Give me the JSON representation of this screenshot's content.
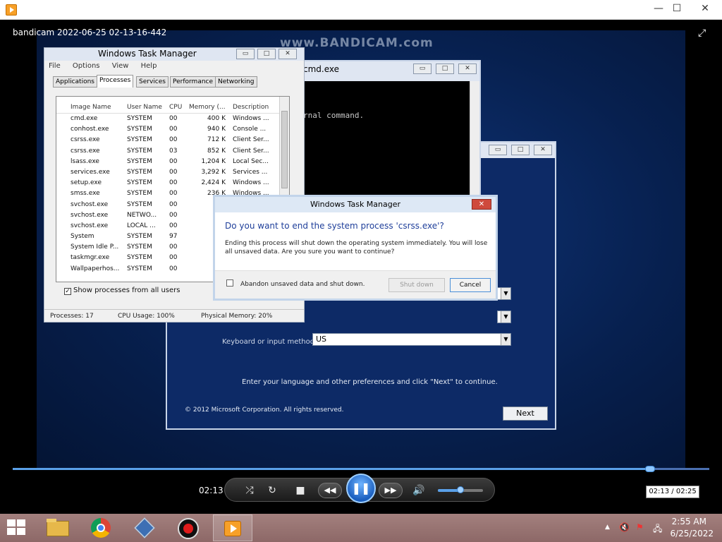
{
  "player": {
    "video_title": "bandicam 2022-06-25 02-13-16-442",
    "elapsed": "02:13",
    "tooltip_time": "02:13 / 02:25",
    "progress_fraction": 0.915,
    "volume_fraction": 0.5,
    "controls": {
      "shuffle_icon": "shuffle-icon",
      "repeat_icon": "repeat-icon",
      "stop_icon": "stop-icon",
      "prev_icon": "rewind-icon",
      "play_icon": "pause-icon",
      "next_icon": "fast-forward-icon",
      "volume_icon": "speaker-icon"
    }
  },
  "watermark": "www.BANDICAM.com",
  "taskmgr": {
    "title": "Windows Task Manager",
    "menu": [
      "File",
      "Options",
      "View",
      "Help"
    ],
    "tabs": [
      "Applications",
      "Processes",
      "Services",
      "Performance",
      "Networking"
    ],
    "active_tab": "Processes",
    "columns": [
      "Image Name",
      "User Name",
      "CPU",
      "Memory (...",
      "Description"
    ],
    "rows": [
      [
        "cmd.exe",
        "SYSTEM",
        "00",
        "400 K",
        "Windows ..."
      ],
      [
        "conhost.exe",
        "SYSTEM",
        "00",
        "940 K",
        "Console ..."
      ],
      [
        "csrss.exe",
        "SYSTEM",
        "00",
        "712 K",
        "Client Ser..."
      ],
      [
        "csrss.exe",
        "SYSTEM",
        "03",
        "852 K",
        "Client Ser..."
      ],
      [
        "lsass.exe",
        "SYSTEM",
        "00",
        "1,204 K",
        "Local Sec..."
      ],
      [
        "services.exe",
        "SYSTEM",
        "00",
        "3,292 K",
        "Services ..."
      ],
      [
        "setup.exe",
        "SYSTEM",
        "00",
        "2,424 K",
        "Windows ..."
      ],
      [
        "smss.exe",
        "SYSTEM",
        "00",
        "236 K",
        "Windows ..."
      ],
      [
        "svchost.exe",
        "SYSTEM",
        "00",
        "9,",
        ""
      ],
      [
        "svchost.exe",
        "NETWO...",
        "00",
        "7:",
        ""
      ],
      [
        "svchost.exe",
        "LOCAL ...",
        "00",
        "0(",
        ""
      ],
      [
        "System",
        "SYSTEM",
        "97",
        "",
        ""
      ],
      [
        "System Idle P...",
        "SYSTEM",
        "00",
        "",
        ""
      ],
      [
        "taskmgr.exe",
        "SYSTEM",
        "00",
        "2,1!",
        ""
      ],
      [
        "Wallpaperhos...",
        "SYSTEM",
        "00",
        "0,3(",
        ""
      ]
    ],
    "show_all_label": "Show processes from all users",
    "status": {
      "processes": "Processes: 17",
      "cpu": "CPU Usage: 100%",
      "memory": "Physical Memory: 20%"
    }
  },
  "cmd": {
    "title": "cmd.exe",
    "console_text": "rnal command."
  },
  "setup": {
    "lang_label": "Keyboard or input method:",
    "keyboard_value": "US",
    "instruction": "Enter your language and other preferences and click \"Next\" to continue.",
    "copyright": "© 2012 Microsoft Corporation. All rights reserved.",
    "next_label": "Next"
  },
  "dialog": {
    "title": "Windows Task Manager",
    "heading": "Do you want to end the system process 'csrss.exe'?",
    "body": "Ending this process will shut down the operating system immediately.  You will lose all unsaved data.  Are you sure you want to continue?",
    "checkbox_label": "Abandon unsaved data and shut down.",
    "shutdown_label": "Shut down",
    "cancel_label": "Cancel"
  },
  "taskbar": {
    "time": "2:55 AM",
    "date": "6/25/2022"
  },
  "colors": {
    "accent": "#1b5fbf",
    "dialog_heading": "#1f3f9a",
    "taskbar": "#8d6867"
  }
}
